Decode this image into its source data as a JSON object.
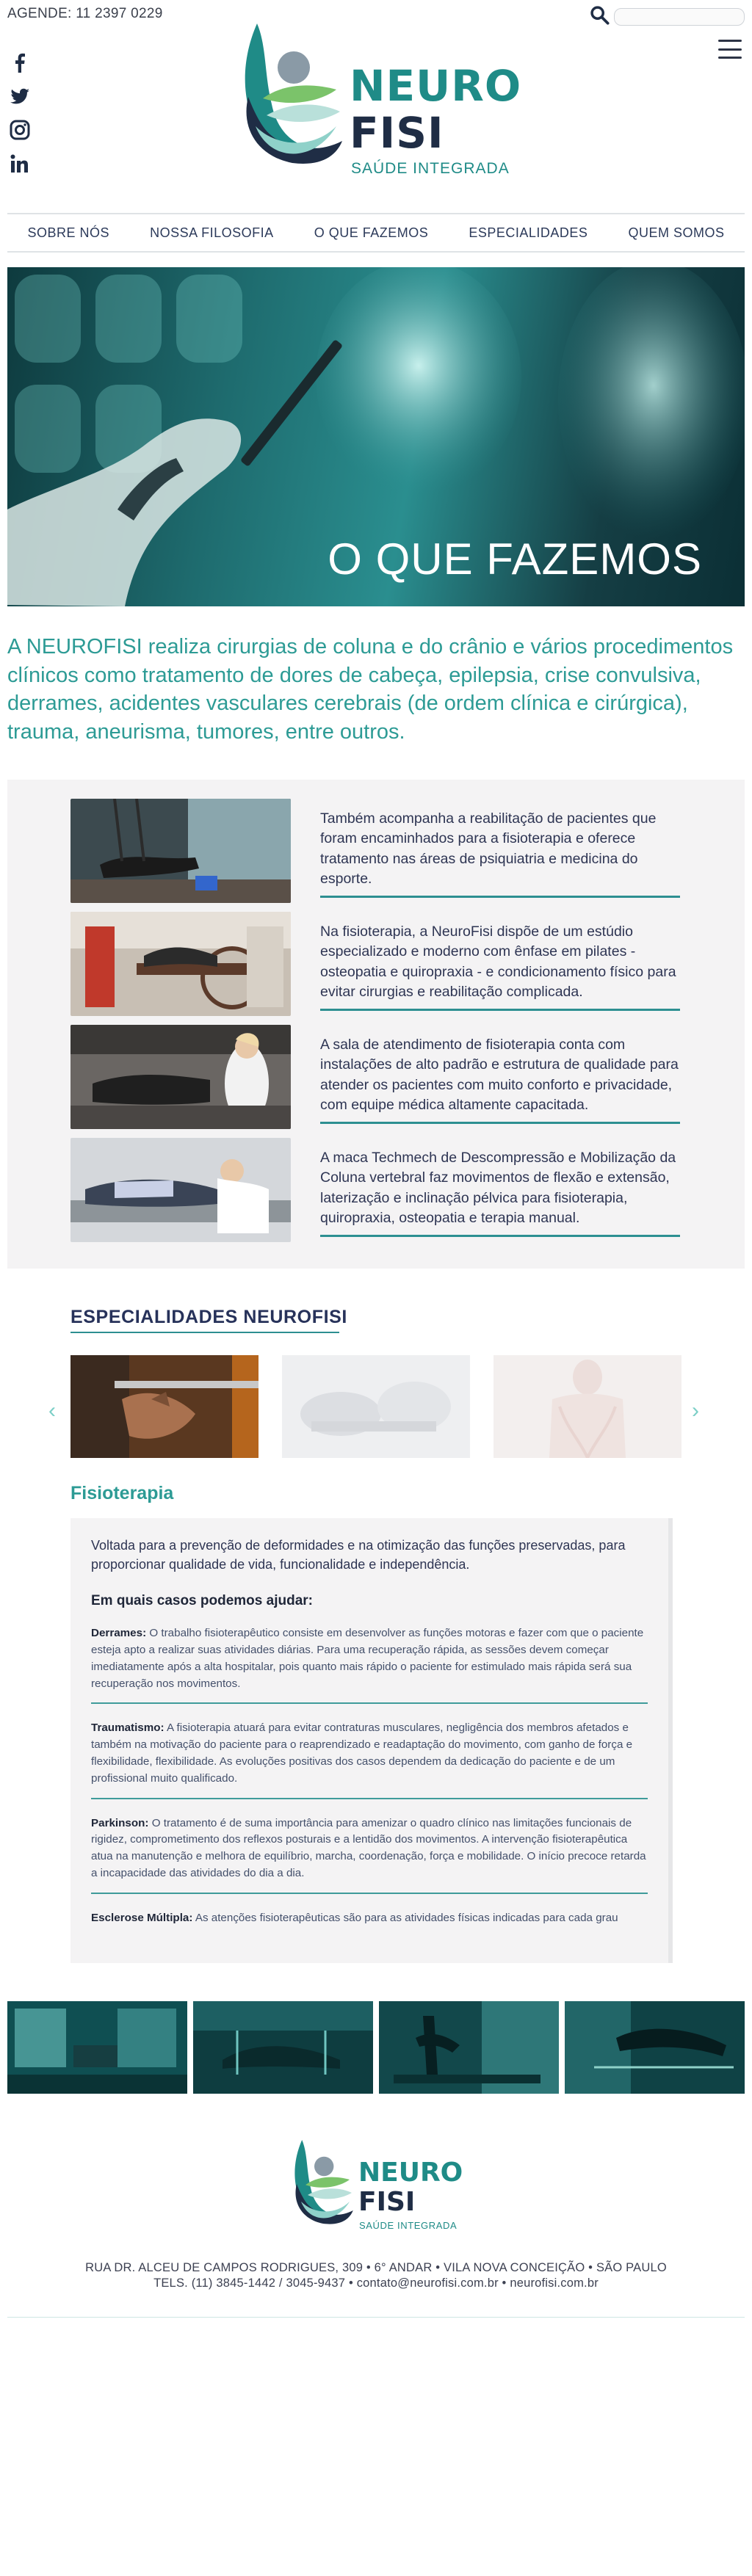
{
  "header": {
    "phone": "AGENDE: 11 2397 0229",
    "search_placeholder": "",
    "social": [
      "facebook-icon",
      "twitter-icon",
      "instagram-icon",
      "linkedin-icon"
    ],
    "logo": {
      "line1": "NEURO",
      "line2": "FISI",
      "tagline": "SAÚDE INTEGRADA"
    }
  },
  "nav": {
    "items": [
      "SOBRE NÓS",
      "NOSSA FILOSOFIA",
      "O QUE FAZEMOS",
      "ESPECIALIDADES",
      "QUEM SOMOS"
    ]
  },
  "hero": {
    "title": "O QUE FAZEMOS"
  },
  "intro": "A NEUROFISI realiza cirurgias de coluna e do crânio e vários procedimentos clínicos como tratamento de dores de cabeça, epilepsia, crise convulsiva, derrames, acidentes vasculares cerebrais (de ordem clínica e cirúrgica), trauma, aneurisma, tumores, entre outros.",
  "services": [
    {
      "text": "Também acompanha a reabilitação de pacientes que foram encaminhados para a fisioterapia e oferece tratamento nas áreas de psiquiatria e medicina do esporte."
    },
    {
      "text": "Na fisioterapia, a NeuroFisi dispõe de um estúdio especializado e moderno com ênfase em pilates - osteopatia e quiropraxia - e condicionamento físico para evitar cirurgias e reabilitação complicada."
    },
    {
      "text": "A sala de atendimento de fisioterapia conta com instalações de alto padrão e estrutura de qualidade para atender os pacientes com muito conforto e privacidade, com equipe médica altamente capacitada."
    },
    {
      "text": "A maca Techmech de Descompressão e Mobilização da Coluna vertebral faz movimentos de flexão e extensão, laterização e inclinação pélvica para fisioterapia, quiropraxia, osteopatia e terapia manual."
    }
  ],
  "specialties": {
    "title": "ESPECIALIDADES NEUROFISI",
    "prev_arrow": "‹",
    "next_arrow": "›",
    "active": "Fisioterapia",
    "intro": "Voltada para a prevenção de deformidades e na otimização das funções preservadas, para proporcionar qualidade de vida, funcionalidade e independência.",
    "question": "Em quais casos podemos ajudar:",
    "items": [
      {
        "term": "Derrames:",
        "text": "O trabalho fisioterapêutico consiste em desenvolver as funções motoras e fazer com que o paciente esteja apto a realizar suas atividades diárias. Para uma recuperação rápida, as sessões devem começar imediatamente após a alta hospitalar, pois quanto mais rápido o paciente for estimulado mais rápida será sua recuperação nos movimentos."
      },
      {
        "term": "Traumatismo:",
        "text": "A fisioterapia atuará para evitar contraturas musculares, negligência dos membros afetados e também na motivação do paciente para o reaprendizado e readaptação do movimento, com ganho de força e flexibilidade, flexibilidade. As evoluções positivas dos casos dependem da dedicação do paciente e de um profissional muito qualificado."
      },
      {
        "term": "Parkinson:",
        "text": "O tratamento é de suma importância para amenizar o quadro clínico nas limitações funcionais de rigidez, comprometimento dos reflexos posturais e a lentidão dos movimentos. A intervenção fisioterapêutica atua na manutenção e melhora de equilíbrio, marcha, coordenação, força e mobilidade. O início precoce retarda a incapacidade das atividades do dia a dia."
      },
      {
        "term": "Esclerose Múltipla:",
        "text": "As atenções fisioterapêuticas são para as atividades físicas indicadas para cada grau"
      }
    ]
  },
  "footer": {
    "logo": {
      "line1": "NEURO",
      "line2": "FISI",
      "tagline": "SAÚDE INTEGRADA"
    },
    "address": "RUA DR. ALCEU DE CAMPOS RODRIGUES, 309 • 6° ANDAR • VILA NOVA CONCEIÇÃO • SÃO PAULO",
    "contact": "TELS. (11) 3845-1442 / 3045-9437 • contato@neurofisi.com.br • neurofisi.com.br"
  },
  "colors": {
    "teal": "#2d9b95",
    "navy": "#27325a",
    "panel": "#f4f3f4"
  }
}
